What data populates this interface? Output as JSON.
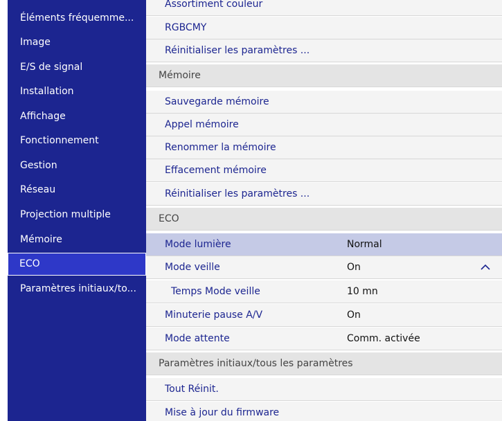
{
  "sidebar": {
    "items": [
      {
        "label": "Éléments fréquemme..."
      },
      {
        "label": "Image"
      },
      {
        "label": "E/S de signal"
      },
      {
        "label": "Installation"
      },
      {
        "label": "Affichage"
      },
      {
        "label": "Fonctionnement"
      },
      {
        "label": "Gestion"
      },
      {
        "label": "Réseau"
      },
      {
        "label": "Projection multiple"
      },
      {
        "label": "Mémoire"
      },
      {
        "label": "ECO"
      },
      {
        "label": "Paramètres initiaux/to..."
      }
    ],
    "selected": "ECO"
  },
  "content": {
    "cut_item": "Assortiment couleur",
    "rows": [
      {
        "kind": "item",
        "label": "RGBCMY"
      },
      {
        "kind": "item",
        "label": "Réinitialiser les paramètres ..."
      },
      {
        "kind": "section",
        "label": "Mémoire"
      },
      {
        "kind": "item",
        "label": "Sauvegarde mémoire"
      },
      {
        "kind": "item",
        "label": "Appel mémoire"
      },
      {
        "kind": "item",
        "label": "Renommer la mémoire"
      },
      {
        "kind": "item",
        "label": "Effacement mémoire"
      },
      {
        "kind": "item",
        "label": "Réinitialiser les paramètres ..."
      },
      {
        "kind": "section",
        "label": "ECO"
      },
      {
        "kind": "item",
        "label": "Mode lumière",
        "value": "Normal",
        "highlighted": true
      },
      {
        "kind": "item",
        "label": "Mode veille",
        "value": "On",
        "icon": "chevron-up-icon"
      },
      {
        "kind": "item",
        "label": "Temps Mode veille",
        "value": "10 mn",
        "sub": true
      },
      {
        "kind": "item",
        "label": "Minuterie pause A/V",
        "value": "On"
      },
      {
        "kind": "item",
        "label": "Mode attente",
        "value": "Comm. activée"
      },
      {
        "kind": "section",
        "label": "Paramètres initiaux/tous les paramètres"
      },
      {
        "kind": "item",
        "label": "Tout Réinit."
      },
      {
        "kind": "item",
        "label": "Mise à jour du firmware"
      }
    ]
  },
  "colors": {
    "sidebar_bg": "#1c2590",
    "selected_bg": "#2e38c8",
    "item_text": "#1c2590",
    "highlight_bg": "#c5cae6",
    "section_bg": "#e4e4e4"
  }
}
